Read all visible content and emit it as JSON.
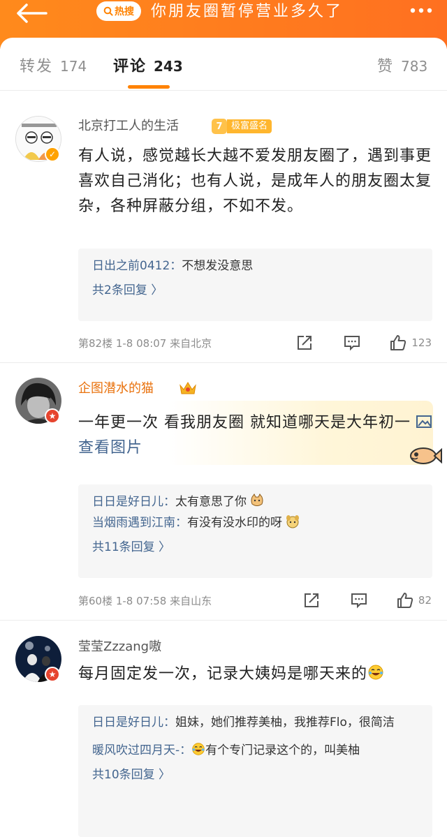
{
  "header": {
    "hot_search_label": "热搜",
    "topic_title": "你朋友圈暂停营业多久了",
    "back_icon": "back-arrow-icon",
    "more_icon": "more-dots-icon",
    "accent": "#ff8200"
  },
  "tabs": [
    {
      "label": "转发",
      "count": "174"
    },
    {
      "label": "评论",
      "count": "243"
    },
    {
      "label": "赞",
      "count": "783"
    }
  ],
  "comments": [
    {
      "username": "北京打工人的生活",
      "honor_level": "7",
      "honor_text": "极富盛名",
      "text": "有人说，感觉越长大越不爱发朋友圈了，遇到事更喜欢自己消化；也有人说，是成年人的朋友圈太复杂，各种屏蔽分组，不如不发。",
      "replies": [
        {
          "user": "日出之前0412：",
          "text": "不想发没意思"
        }
      ],
      "reply_more": "共2条回复 〉",
      "meta": "第82楼 1-8 08:07 来自北京",
      "likes": "123"
    },
    {
      "username": "企图潜水的猫",
      "text": "一年更一次 看我朋友圈 就知道哪天是大年初一 ",
      "view_pic": "查看图片",
      "replies": [
        {
          "user": "日日是好日儿：",
          "text": "太有意思了你"
        },
        {
          "user": "当烟雨遇到江南：",
          "text": "有没有没水印的呀"
        }
      ],
      "reply_more": "共11条回复 〉",
      "meta": "第60楼 1-8 07:58 来自山东",
      "likes": "82"
    },
    {
      "username": "莹莹Zzzang嗷",
      "text": "每月固定发一次，记录大姨妈是哪天来的",
      "replies": [
        {
          "user": "日日是好日儿：",
          "text": "姐妹，她们推荐美柚，我推荐Flo，很简洁"
        },
        {
          "user": "暖风吹过四月天-：",
          "text": "有个专门记录这个的，叫美柚"
        }
      ],
      "reply_more": "共10条回复 〉"
    }
  ]
}
